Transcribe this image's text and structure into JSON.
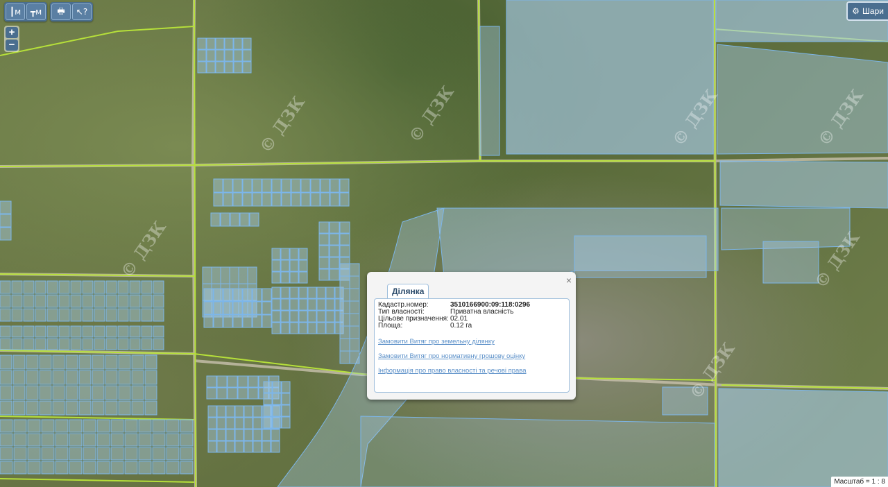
{
  "toolbar": {
    "group1": [
      {
        "icon": "ruler-line-icon",
        "glyph": "┃м"
      },
      {
        "icon": "ruler-area-icon",
        "glyph": "┳м"
      }
    ],
    "group2": [
      {
        "icon": "print-icon",
        "glyph": "🖶"
      },
      {
        "icon": "info-cursor-icon",
        "glyph": "↖?"
      }
    ]
  },
  "zoom": {
    "in": "+",
    "out": "−"
  },
  "layers_button": {
    "label": "Шари"
  },
  "watermark": "© ДЗК",
  "popup": {
    "tab": "Ділянка",
    "close": "×",
    "fields": [
      {
        "label": "Кадастр.номер:",
        "value": "3510166900:09:118:0296"
      },
      {
        "label": "Тип власності:",
        "value": "Приватна власність"
      },
      {
        "label": "Цільове призначення:",
        "value": "02.01"
      },
      {
        "label": "Площа:",
        "value": "0.12 га"
      }
    ],
    "links": [
      "Замовити Витяг про земельну ділянку",
      "Замовити Витяг про нормативну грошову оцінку",
      "Інформація про право власності та речові права"
    ]
  },
  "scale": "Масштаб = 1 : 8",
  "colors": {
    "parcel_fill": "#a7cbe8",
    "parcel_stroke": "#7cb6ea",
    "boundary": "#b6e03a",
    "road": "#c9c2ae"
  }
}
